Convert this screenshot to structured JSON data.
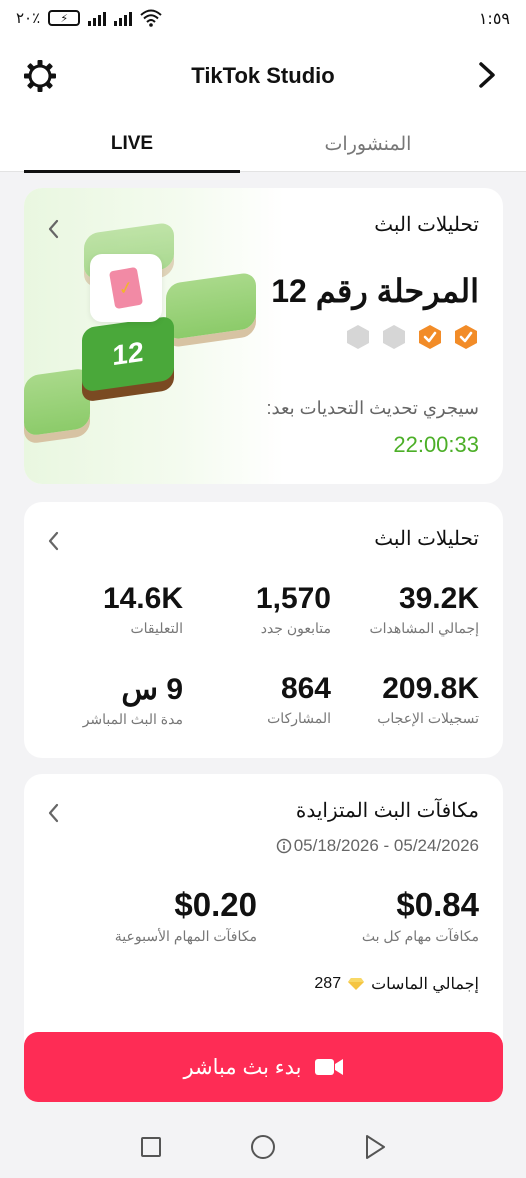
{
  "status_bar": {
    "battery": "٢٠٪",
    "time": "١:٥٩"
  },
  "header": {
    "title": "TikTok Studio"
  },
  "tabs": {
    "live": "LIVE",
    "posts": "المنشورات"
  },
  "challenge_card": {
    "title": "تحليلات البث",
    "stage": "المرحلة رقم 12",
    "level_badge": "12",
    "refresh_label": "سيجري تحديث التحديات بعد:",
    "timer": "22:00:33",
    "badges_completed": 2,
    "badges_total": 4
  },
  "analytics_card": {
    "title": "تحليلات البث",
    "stats": [
      {
        "value": "39.2K",
        "label": "إجمالي المشاهدات"
      },
      {
        "value": "1,570",
        "label": "متابعون جدد"
      },
      {
        "value": "14.6K",
        "label": "التعليقات"
      },
      {
        "value": "209.8K",
        "label": "تسجيلات الإعجاب"
      },
      {
        "value": "864",
        "label": "المشاركات"
      },
      {
        "value": "9 س",
        "label": "مدة البث المباشر"
      }
    ]
  },
  "rewards_card": {
    "title": "مكافآت البث المتزايدة",
    "date_range": "05/18/2026 - 05/24/2026",
    "per_live_value": "$0.84",
    "per_live_label": "مكافآت مهام كل بث",
    "weekly_value": "$0.20",
    "weekly_label": "مكافآت المهام الأسبوعية",
    "diamonds_label": "إجمالي الماسات",
    "diamonds_value": "287"
  },
  "go_live_button": {
    "label": "بدء بث مباشر"
  },
  "colors": {
    "accent": "#fe2c55",
    "timer": "#4caf28",
    "badge_orange": "#f28c28"
  }
}
